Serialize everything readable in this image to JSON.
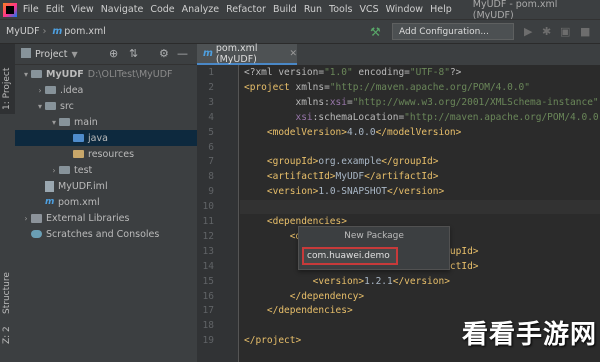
{
  "menu": {
    "items": [
      "File",
      "Edit",
      "View",
      "Navigate",
      "Code",
      "Analyze",
      "Refactor",
      "Build",
      "Run",
      "Tools",
      "VCS",
      "Window",
      "Help"
    ],
    "window_title": "MyUDF - pom.xml (MyUDF)"
  },
  "navbar": {
    "project": "MyUDF",
    "separator": "›",
    "file": "pom.xml",
    "file_icon": "m",
    "add_configuration": "Add Configuration..."
  },
  "left_stripe": {
    "project_tab": "1: Project",
    "structure_tab": "Structure",
    "structure_num": "Z: 2"
  },
  "project_panel": {
    "title": "Project",
    "tree": [
      {
        "label": "MyUDF",
        "extra": "D:\\OLITest\\MyUDF",
        "depth": 0,
        "arrow": "▾",
        "icon": "folder"
      },
      {
        "label": ".idea",
        "extra": "",
        "depth": 1,
        "arrow": "›",
        "icon": "folder"
      },
      {
        "label": "src",
        "extra": "",
        "depth": 1,
        "arrow": "▾",
        "icon": "folder"
      },
      {
        "label": "main",
        "extra": "",
        "depth": 2,
        "arrow": "▾",
        "icon": "folder"
      },
      {
        "label": "java",
        "extra": "",
        "depth": 3,
        "arrow": "",
        "icon": "folder-blue"
      },
      {
        "label": "resources",
        "extra": "",
        "depth": 3,
        "arrow": "",
        "icon": "folder-tan"
      },
      {
        "label": "test",
        "extra": "",
        "depth": 2,
        "arrow": "›",
        "icon": "folder"
      },
      {
        "label": "MyUDF.iml",
        "extra": "",
        "depth": 1,
        "arrow": "",
        "icon": "file"
      },
      {
        "label": "pom.xml",
        "extra": "",
        "depth": 1,
        "arrow": "",
        "icon": "file-m"
      },
      {
        "label": "External Libraries",
        "extra": "",
        "depth": 0,
        "arrow": "›",
        "icon": "libraries"
      },
      {
        "label": "Scratches and Consoles",
        "extra": "",
        "depth": 0,
        "arrow": "",
        "icon": "scratches"
      }
    ]
  },
  "editor": {
    "tab_label": "pom.xml (MyUDF)",
    "lines": [
      {
        "n": "1",
        "html": "<span class='attr'>&lt;?xml version=</span><span class='str'>\"1.0\"</span><span class='attr'> encoding=</span><span class='str'>\"UTF-8\"</span><span class='attr'>?&gt;</span>"
      },
      {
        "n": "2",
        "html": "<span class='tag'>&lt;project </span><span class='attr'>xmlns=</span><span class='str'>\"http://maven.apache.org/POM/4.0.0\"</span>"
      },
      {
        "n": "3",
        "html": "         <span class='attr'>xmlns:</span><span class='ns'>xsi</span><span class='attr'>=</span><span class='str'>\"http://www.w3.org/2001/XMLSchema-instance\"</span>"
      },
      {
        "n": "4",
        "html": "         <span class='ns'>xsi</span><span class='attr'>:schemaLocation=</span><span class='str'>\"http://maven.apache.org/POM/4.0.0 ht</span>"
      },
      {
        "n": "5",
        "html": "    <span class='tag'>&lt;modelVersion&gt;</span><span class='txt'>4.0.0</span><span class='tag'>&lt;/modelVersion&gt;</span>"
      },
      {
        "n": "6",
        "html": ""
      },
      {
        "n": "7",
        "html": "    <span class='tag'>&lt;groupId&gt;</span><span class='txt'>org.example</span><span class='tag'>&lt;/groupId&gt;</span>"
      },
      {
        "n": "8",
        "html": "    <span class='tag'>&lt;artifactId&gt;</span><span class='txt'>MyUDF</span><span class='tag'>&lt;/artifactId&gt;</span>"
      },
      {
        "n": "9",
        "html": "    <span class='tag'>&lt;version&gt;</span><span class='txt'>1.0-SNAPSHOT</span><span class='tag'>&lt;/version&gt;</span>"
      },
      {
        "n": "10",
        "html": ""
      },
      {
        "n": "11",
        "html": "    <span class='tag'>&lt;dependencies&gt;</span>"
      },
      {
        "n": "12",
        "html": "        <span class='tag'>&lt;d</span>"
      },
      {
        "n": "13",
        "html": "                              <span class='tag'>&gt;&lt;/groupId&gt;</span>"
      },
      {
        "n": "14",
        "html": "                              <span class='tag'>artifactId&gt;</span>"
      },
      {
        "n": "15",
        "html": "            <span class='tag'>&lt;version&gt;</span><span class='txt'>1.2.1</span><span class='tag'>&lt;/version&gt;</span>"
      },
      {
        "n": "16",
        "html": "        <span class='tag'>&lt;/dependency&gt;</span>"
      },
      {
        "n": "17",
        "html": "    <span class='tag'>&lt;/dependencies&gt;</span>"
      },
      {
        "n": "18",
        "html": ""
      },
      {
        "n": "19",
        "html": "<span class='tag'>&lt;/project&gt;</span>"
      }
    ]
  },
  "popup": {
    "title": "New Package",
    "input_value": "com.huawei.demo"
  },
  "watermark": "看看手游网",
  "colors": {
    "accent": "#4a88c7",
    "highlight_border": "#c73a3a",
    "run_green": "#59a869"
  }
}
